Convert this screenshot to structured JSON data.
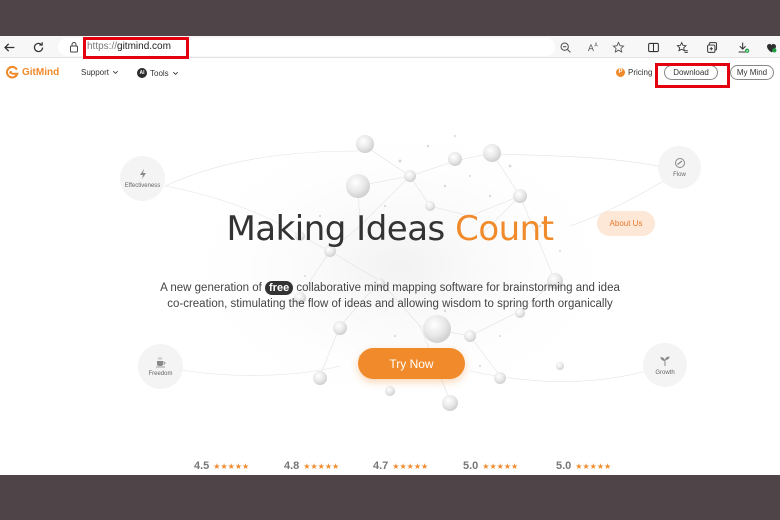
{
  "browser": {
    "url_scheme": "https://",
    "url_host": "gitmind.com"
  },
  "site": {
    "brand": "GitMind",
    "nav": {
      "support": "Support",
      "tools_badge": "AI",
      "tools": "Tools",
      "pricing_badge": "P",
      "pricing": "Pricing",
      "download": "Download",
      "my_mind": "My Mind"
    }
  },
  "hero": {
    "headline_main": "Making Ideas",
    "headline_accent": "Count",
    "subtitle_pre": "A new generation of",
    "subtitle_badge": "free",
    "subtitle_line1_post": "collaborative mind mapping software for brainstorming and idea",
    "subtitle_line2": "co-creation, stimulating the flow of ideas and allowing wisdom to spring forth organically",
    "cta": "Try Now",
    "about": "About Us",
    "features": {
      "effectiveness": "Effectiveness",
      "flow": "Flow",
      "freedom": "Freedom",
      "growth": "Growth"
    }
  },
  "ratings": [
    {
      "score": "4.5",
      "stars": "★★★★★"
    },
    {
      "score": "4.8",
      "stars": "★★★★★"
    },
    {
      "score": "4.7",
      "stars": "★★★★★"
    },
    {
      "score": "5.0",
      "stars": "★★★★★"
    },
    {
      "score": "5.0",
      "stars": "★★★★★"
    }
  ],
  "colors": {
    "accent": "#f08a2b",
    "highlight_box": "#e3000f",
    "backdrop": "#4f4549"
  },
  "icons": {
    "back": "back-arrow-icon",
    "refresh": "refresh-icon",
    "lock": "lock-icon",
    "zoom": "zoom-icon",
    "read_aloud": "read-aloud-icon",
    "favorite": "star-icon",
    "split": "split-screen-icon",
    "favorites": "favorites-icon",
    "collections": "collections-icon",
    "downloads": "downloads-icon",
    "copilot": "heart-icon"
  }
}
